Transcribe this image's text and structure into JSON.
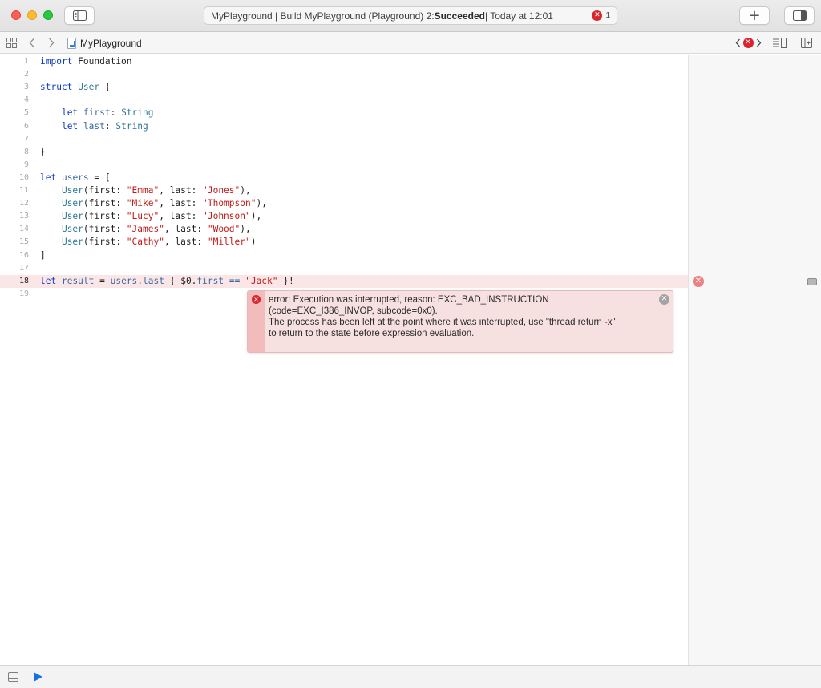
{
  "window": {
    "activity": {
      "prefix": "MyPlayground | Build MyPlayground (Playground) 2: ",
      "status": "Succeeded",
      "suffix": " | Today at 12:01",
      "error_badge_glyph": "✕",
      "error_count": "1"
    },
    "buttons": {
      "add_label": "+"
    }
  },
  "jumpbar": {
    "file_name": "MyPlayground",
    "issue_glyph": "✕"
  },
  "editor": {
    "lines": [
      {
        "n": "1",
        "tokens": [
          [
            "kw",
            "import"
          ],
          [
            "pl",
            " Foundation"
          ]
        ]
      },
      {
        "n": "2",
        "tokens": []
      },
      {
        "n": "3",
        "tokens": [
          [
            "kw",
            "struct"
          ],
          [
            "pl",
            " "
          ],
          [
            "ty",
            "User"
          ],
          [
            "pl",
            " {"
          ]
        ]
      },
      {
        "n": "4",
        "tokens": []
      },
      {
        "n": "5",
        "tokens": [
          [
            "pl",
            "    "
          ],
          [
            "kw",
            "let"
          ],
          [
            "pl",
            " "
          ],
          [
            "id",
            "first"
          ],
          [
            "pl",
            ": "
          ],
          [
            "ty",
            "String"
          ]
        ]
      },
      {
        "n": "6",
        "tokens": [
          [
            "pl",
            "    "
          ],
          [
            "kw",
            "let"
          ],
          [
            "pl",
            " "
          ],
          [
            "id",
            "last"
          ],
          [
            "pl",
            ": "
          ],
          [
            "ty",
            "String"
          ]
        ]
      },
      {
        "n": "7",
        "tokens": []
      },
      {
        "n": "8",
        "tokens": [
          [
            "pl",
            "}"
          ]
        ]
      },
      {
        "n": "9",
        "tokens": []
      },
      {
        "n": "10",
        "tokens": [
          [
            "kw",
            "let"
          ],
          [
            "pl",
            " "
          ],
          [
            "id",
            "users"
          ],
          [
            "pl",
            " = ["
          ]
        ]
      },
      {
        "n": "11",
        "tokens": [
          [
            "pl",
            "    "
          ],
          [
            "ty",
            "User"
          ],
          [
            "pl",
            "(first: "
          ],
          [
            "st",
            "\"Emma\""
          ],
          [
            "pl",
            ", last: "
          ],
          [
            "st",
            "\"Jones\""
          ],
          [
            "pl",
            "),"
          ]
        ]
      },
      {
        "n": "12",
        "tokens": [
          [
            "pl",
            "    "
          ],
          [
            "ty",
            "User"
          ],
          [
            "pl",
            "(first: "
          ],
          [
            "st",
            "\"Mike\""
          ],
          [
            "pl",
            ", last: "
          ],
          [
            "st",
            "\"Thompson\""
          ],
          [
            "pl",
            "),"
          ]
        ]
      },
      {
        "n": "13",
        "tokens": [
          [
            "pl",
            "    "
          ],
          [
            "ty",
            "User"
          ],
          [
            "pl",
            "(first: "
          ],
          [
            "st",
            "\"Lucy\""
          ],
          [
            "pl",
            ", last: "
          ],
          [
            "st",
            "\"Johnson\""
          ],
          [
            "pl",
            "),"
          ]
        ]
      },
      {
        "n": "14",
        "tokens": [
          [
            "pl",
            "    "
          ],
          [
            "ty",
            "User"
          ],
          [
            "pl",
            "(first: "
          ],
          [
            "st",
            "\"James\""
          ],
          [
            "pl",
            ", last: "
          ],
          [
            "st",
            "\"Wood\""
          ],
          [
            "pl",
            "),"
          ]
        ]
      },
      {
        "n": "15",
        "tokens": [
          [
            "pl",
            "    "
          ],
          [
            "ty",
            "User"
          ],
          [
            "pl",
            "(first: "
          ],
          [
            "st",
            "\"Cathy\""
          ],
          [
            "pl",
            ", last: "
          ],
          [
            "st",
            "\"Miller\""
          ],
          [
            "pl",
            ")"
          ]
        ]
      },
      {
        "n": "16",
        "tokens": [
          [
            "pl",
            "]"
          ]
        ]
      },
      {
        "n": "17",
        "tokens": []
      },
      {
        "n": "18",
        "tokens": [
          [
            "kw",
            "let"
          ],
          [
            "pl",
            " "
          ],
          [
            "id",
            "result"
          ],
          [
            "pl",
            " = "
          ],
          [
            "id",
            "users"
          ],
          [
            "pl",
            "."
          ],
          [
            "id",
            "last"
          ],
          [
            "pl",
            " { $0."
          ],
          [
            "id",
            "first"
          ],
          [
            "pl",
            " "
          ],
          [
            "id",
            "=="
          ],
          [
            "pl",
            " "
          ],
          [
            "st",
            "\"Jack\""
          ],
          [
            "pl",
            " }!"
          ]
        ],
        "current": true
      },
      {
        "n": "19",
        "tokens": []
      }
    ]
  },
  "error": {
    "icon_glyph": "✕",
    "dismiss_glyph": "✕",
    "message": "error: Execution was interrupted, reason: EXC_BAD_INSTRUCTION\n(code=EXC_I386_INVOP, subcode=0x0).\nThe process has been left at the point where it was interrupted, use \"thread return -x\"\nto return to the state before expression evaluation."
  },
  "results": {
    "error_glyph": "✕"
  },
  "colors": {
    "keyword": "#0f3fc0",
    "type": "#2f7a96",
    "string": "#c41a16",
    "identifier": "#3a6aa0",
    "error_line_bg": "#fae6e6",
    "error_bubble_bg": "#f6e0e0",
    "run_button": "#1b6fe0"
  },
  "icons": {
    "sidebar_toggle": "sidebar-left-icon",
    "inspector_toggle": "sidebar-right-icon",
    "related_items": "grid-icon",
    "nav_back": "chevron-left-icon",
    "nav_forward": "chevron-right-icon",
    "editor_options": "lines-icon",
    "split_editor": "split-plus-icon",
    "debug_area": "debug-area-icon",
    "run": "play-icon"
  }
}
